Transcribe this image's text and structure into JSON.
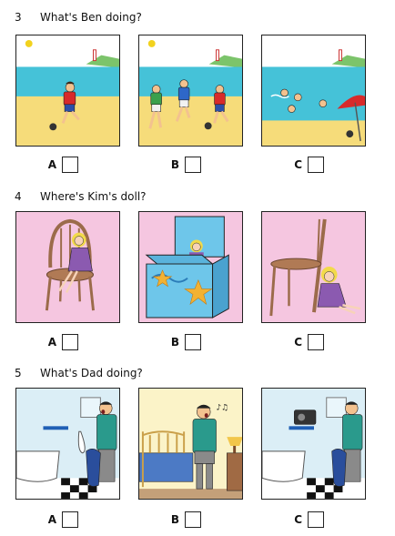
{
  "questions": [
    {
      "number": "3",
      "text": "What's Ben doing?",
      "options": [
        "A",
        "B",
        "C"
      ],
      "colors": {
        "sky": "#ffffff",
        "sea": "#45c2d8",
        "sand": "#f6dc7a"
      }
    },
    {
      "number": "4",
      "text": "Where's Kim's doll?",
      "options": [
        "A",
        "B",
        "C"
      ],
      "colors": {
        "background": "#f5c6e0",
        "box": "#6ec6ea",
        "star": "#f2b233"
      }
    },
    {
      "number": "5",
      "text": "What's Dad doing?",
      "options": [
        "A",
        "B",
        "C"
      ],
      "colors": {
        "wall": "#dbeef6",
        "bedroom": "#fbf3c8",
        "shirt": "#2a9a8c"
      }
    }
  ]
}
